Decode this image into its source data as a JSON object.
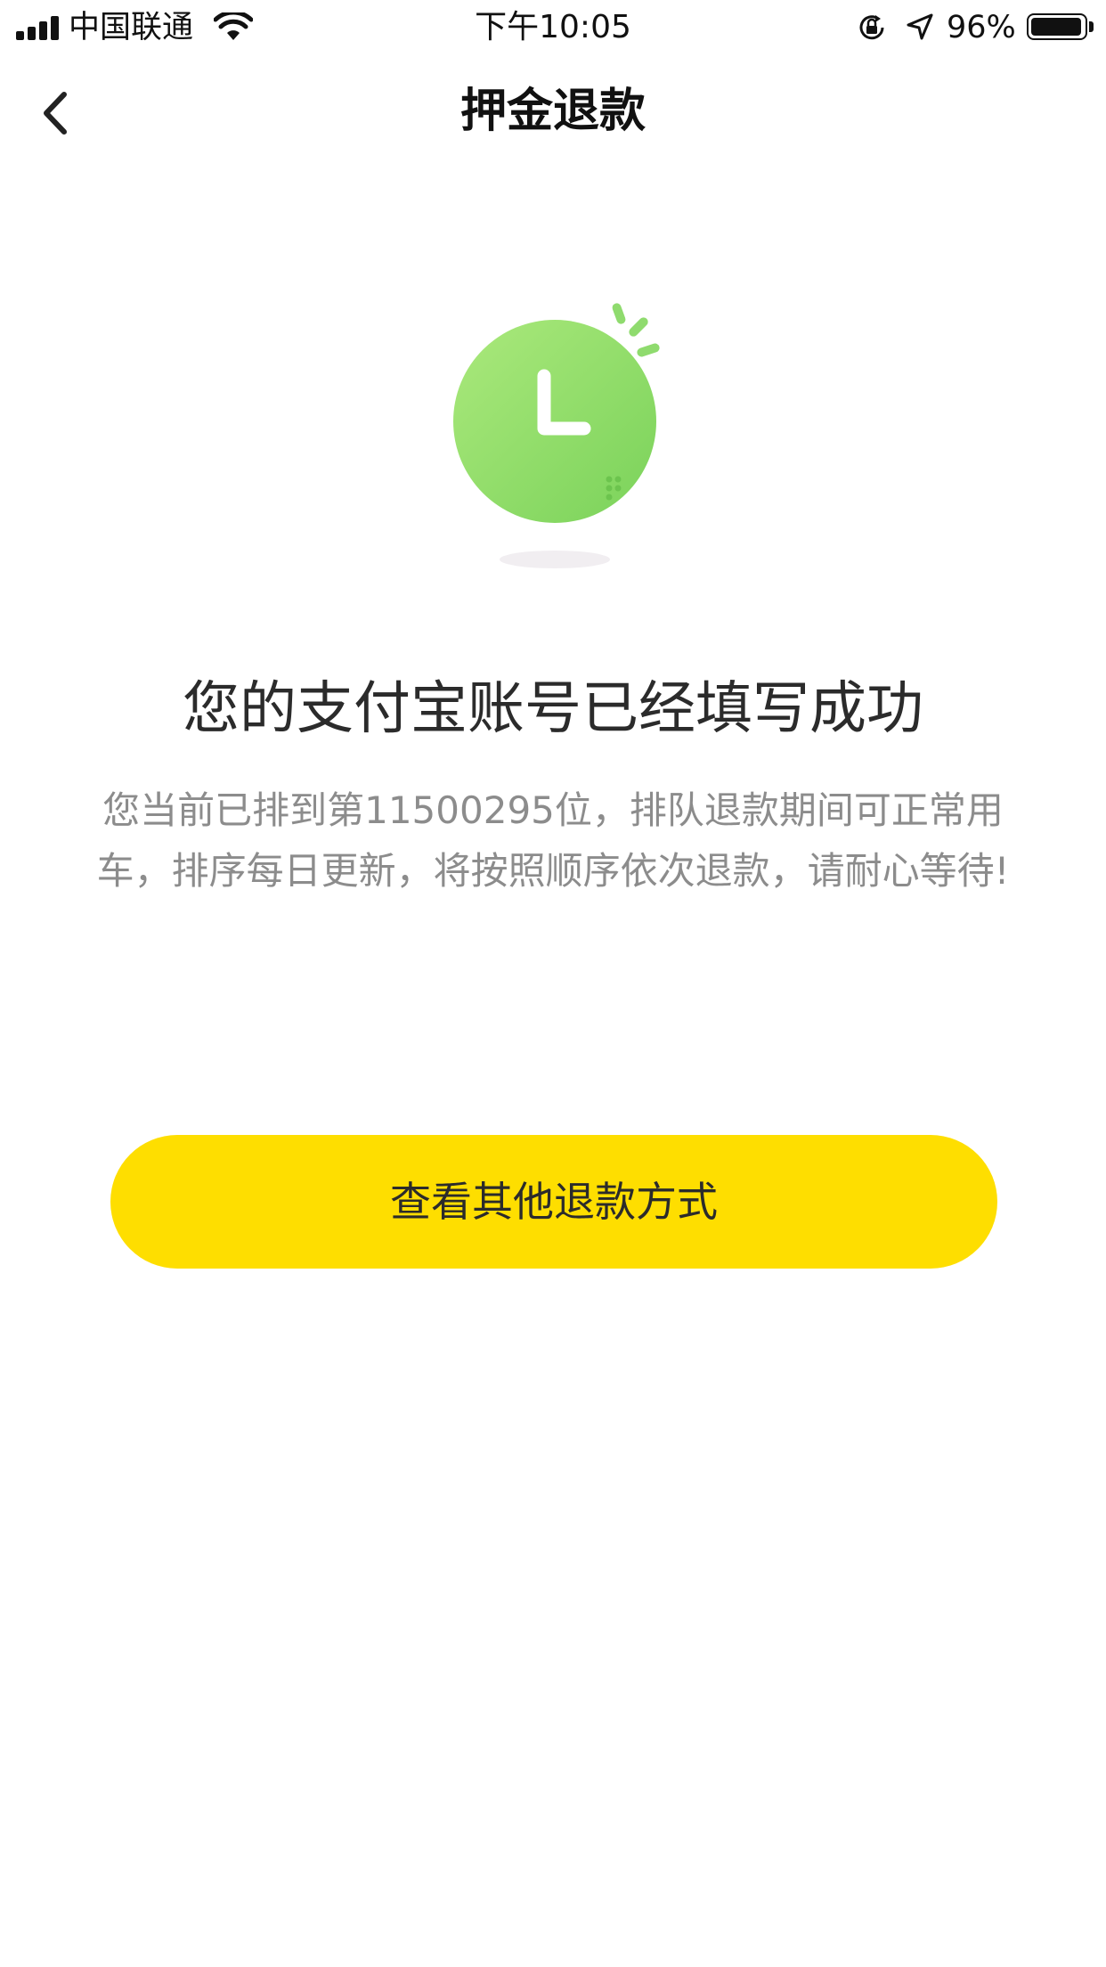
{
  "status_bar": {
    "carrier": "中国联通",
    "time": "下午10:05",
    "battery_percent": "96%",
    "battery_level": 0.96,
    "icons": [
      "signal-icon",
      "wifi-icon",
      "orientation-lock-icon",
      "location-icon",
      "battery-icon"
    ]
  },
  "nav": {
    "title": "押金退款",
    "back_icon": "chevron-left-icon"
  },
  "illustration": {
    "icon": "clock-icon",
    "colors": {
      "circle_light": "#a9e87a",
      "circle_dark": "#7fd35c",
      "shadow": "#f0eef0"
    }
  },
  "content": {
    "headline": "您的支付宝账号已经填写成功",
    "description": "您当前已排到第11500295位，排队退款期间可正常用车，排序每日更新，将按照顺序依次退款，请耐心等待!"
  },
  "actions": {
    "other_refund_label": "查看其他退款方式"
  },
  "colors": {
    "accent": "#fede00",
    "headline_text": "#2b2b2b",
    "secondary_text": "#8c8c8c",
    "background": "#ffffff"
  }
}
